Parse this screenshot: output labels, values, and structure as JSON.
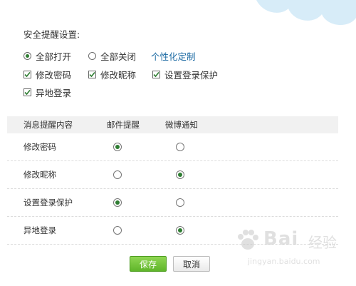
{
  "settings": {
    "title": "安全提醒设置:",
    "radio_all_on": "全部打开",
    "radio_all_off": "全部关闭",
    "custom_link": "个性化定制",
    "checks": [
      "修改密码",
      "修改昵称",
      "设置登录保护",
      "异地登录"
    ]
  },
  "table": {
    "headers": [
      "消息提醒内容",
      "邮件提醒",
      "微博通知"
    ],
    "rows": [
      {
        "label": "修改密码",
        "email": true,
        "weibo": false
      },
      {
        "label": "修改昵称",
        "email": false,
        "weibo": true
      },
      {
        "label": "设置登录保护",
        "email": true,
        "weibo": false
      },
      {
        "label": "异地登录",
        "email": false,
        "weibo": true
      }
    ]
  },
  "buttons": {
    "save": "保存",
    "cancel": "取消"
  },
  "watermark": {
    "brand": "Bai",
    "cn": "经验",
    "url": "jingyan.baidu.com"
  },
  "colors": {
    "accent_green": "#5fb52a",
    "link_blue": "#1c6aa3",
    "radio_green": "#2e7d32"
  }
}
